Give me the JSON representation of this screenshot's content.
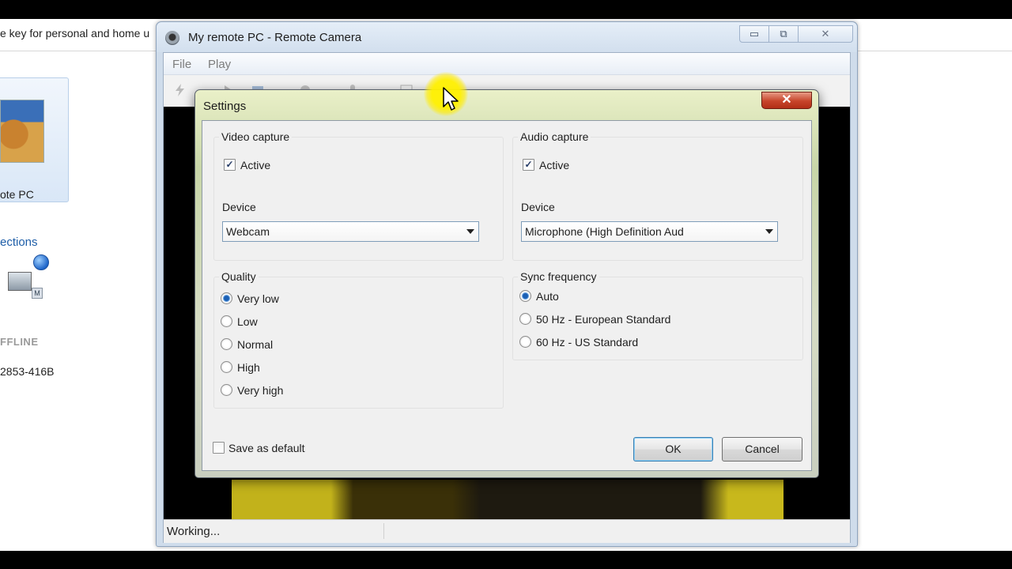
{
  "background_app": {
    "banner_text": "e key for personal and home u",
    "tile_label": "ote PC",
    "section_link": "ections",
    "computer_status": "FFLINE",
    "computer_id": "2853-416B"
  },
  "window": {
    "title": "My remote PC - Remote Camera",
    "controls": {
      "minimize": "▭",
      "maximize": "⧉",
      "close": "✕"
    },
    "menu": {
      "file": "File",
      "play": "Play"
    },
    "status": "Working..."
  },
  "dialog": {
    "title": "Settings",
    "close": "✕",
    "video": {
      "group_label": "Video capture",
      "active_label": "Active",
      "active": true,
      "device_label": "Device",
      "device_value": "Webcam"
    },
    "audio": {
      "group_label": "Audio capture",
      "active_label": "Active",
      "active": true,
      "device_label": "Device",
      "device_value": "Microphone (High Definition Aud"
    },
    "quality": {
      "group_label": "Quality",
      "options": [
        "Very low",
        "Low",
        "Normal",
        "High",
        "Very high"
      ],
      "selected": "Very low"
    },
    "sync": {
      "group_label": "Sync frequency",
      "options": [
        "Auto",
        "50 Hz - European Standard",
        "60 Hz - US Standard"
      ],
      "selected": "Auto"
    },
    "save_default_label": "Save as default",
    "save_default": false,
    "ok_label": "OK",
    "cancel_label": "Cancel",
    "check_mark": "✓"
  },
  "colors": {
    "accent": "#1a5fb4",
    "cursor_highlight": "#ffee00"
  }
}
